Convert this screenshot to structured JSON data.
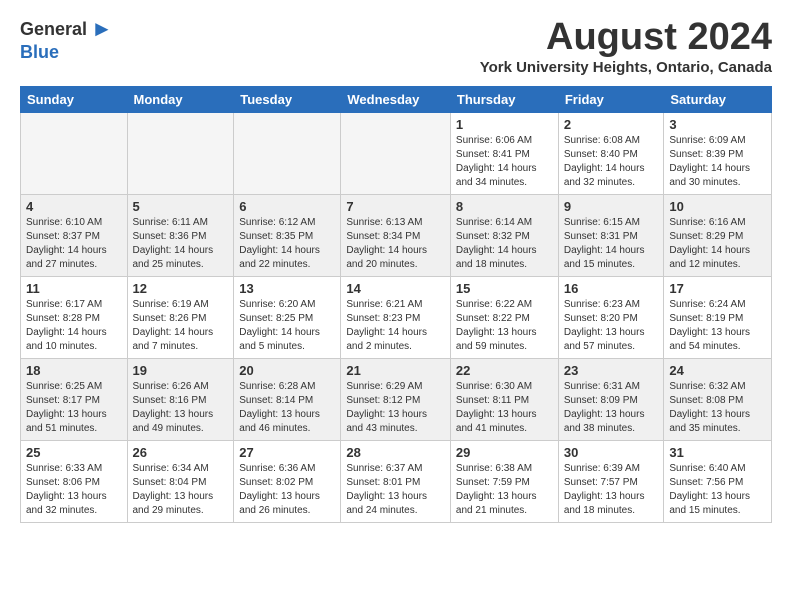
{
  "logo": {
    "general": "General",
    "blue": "Blue"
  },
  "title": "August 2024",
  "location": "York University Heights, Ontario, Canada",
  "days_of_week": [
    "Sunday",
    "Monday",
    "Tuesday",
    "Wednesday",
    "Thursday",
    "Friday",
    "Saturday"
  ],
  "weeks": [
    [
      {
        "day": "",
        "sunrise": "",
        "sunset": "",
        "daylight": ""
      },
      {
        "day": "",
        "sunrise": "",
        "sunset": "",
        "daylight": ""
      },
      {
        "day": "",
        "sunrise": "",
        "sunset": "",
        "daylight": ""
      },
      {
        "day": "",
        "sunrise": "",
        "sunset": "",
        "daylight": ""
      },
      {
        "day": "1",
        "sunrise": "Sunrise: 6:06 AM",
        "sunset": "Sunset: 8:41 PM",
        "daylight": "Daylight: 14 hours and 34 minutes."
      },
      {
        "day": "2",
        "sunrise": "Sunrise: 6:08 AM",
        "sunset": "Sunset: 8:40 PM",
        "daylight": "Daylight: 14 hours and 32 minutes."
      },
      {
        "day": "3",
        "sunrise": "Sunrise: 6:09 AM",
        "sunset": "Sunset: 8:39 PM",
        "daylight": "Daylight: 14 hours and 30 minutes."
      }
    ],
    [
      {
        "day": "4",
        "sunrise": "Sunrise: 6:10 AM",
        "sunset": "Sunset: 8:37 PM",
        "daylight": "Daylight: 14 hours and 27 minutes."
      },
      {
        "day": "5",
        "sunrise": "Sunrise: 6:11 AM",
        "sunset": "Sunset: 8:36 PM",
        "daylight": "Daylight: 14 hours and 25 minutes."
      },
      {
        "day": "6",
        "sunrise": "Sunrise: 6:12 AM",
        "sunset": "Sunset: 8:35 PM",
        "daylight": "Daylight: 14 hours and 22 minutes."
      },
      {
        "day": "7",
        "sunrise": "Sunrise: 6:13 AM",
        "sunset": "Sunset: 8:34 PM",
        "daylight": "Daylight: 14 hours and 20 minutes."
      },
      {
        "day": "8",
        "sunrise": "Sunrise: 6:14 AM",
        "sunset": "Sunset: 8:32 PM",
        "daylight": "Daylight: 14 hours and 18 minutes."
      },
      {
        "day": "9",
        "sunrise": "Sunrise: 6:15 AM",
        "sunset": "Sunset: 8:31 PM",
        "daylight": "Daylight: 14 hours and 15 minutes."
      },
      {
        "day": "10",
        "sunrise": "Sunrise: 6:16 AM",
        "sunset": "Sunset: 8:29 PM",
        "daylight": "Daylight: 14 hours and 12 minutes."
      }
    ],
    [
      {
        "day": "11",
        "sunrise": "Sunrise: 6:17 AM",
        "sunset": "Sunset: 8:28 PM",
        "daylight": "Daylight: 14 hours and 10 minutes."
      },
      {
        "day": "12",
        "sunrise": "Sunrise: 6:19 AM",
        "sunset": "Sunset: 8:26 PM",
        "daylight": "Daylight: 14 hours and 7 minutes."
      },
      {
        "day": "13",
        "sunrise": "Sunrise: 6:20 AM",
        "sunset": "Sunset: 8:25 PM",
        "daylight": "Daylight: 14 hours and 5 minutes."
      },
      {
        "day": "14",
        "sunrise": "Sunrise: 6:21 AM",
        "sunset": "Sunset: 8:23 PM",
        "daylight": "Daylight: 14 hours and 2 minutes."
      },
      {
        "day": "15",
        "sunrise": "Sunrise: 6:22 AM",
        "sunset": "Sunset: 8:22 PM",
        "daylight": "Daylight: 13 hours and 59 minutes."
      },
      {
        "day": "16",
        "sunrise": "Sunrise: 6:23 AM",
        "sunset": "Sunset: 8:20 PM",
        "daylight": "Daylight: 13 hours and 57 minutes."
      },
      {
        "day": "17",
        "sunrise": "Sunrise: 6:24 AM",
        "sunset": "Sunset: 8:19 PM",
        "daylight": "Daylight: 13 hours and 54 minutes."
      }
    ],
    [
      {
        "day": "18",
        "sunrise": "Sunrise: 6:25 AM",
        "sunset": "Sunset: 8:17 PM",
        "daylight": "Daylight: 13 hours and 51 minutes."
      },
      {
        "day": "19",
        "sunrise": "Sunrise: 6:26 AM",
        "sunset": "Sunset: 8:16 PM",
        "daylight": "Daylight: 13 hours and 49 minutes."
      },
      {
        "day": "20",
        "sunrise": "Sunrise: 6:28 AM",
        "sunset": "Sunset: 8:14 PM",
        "daylight": "Daylight: 13 hours and 46 minutes."
      },
      {
        "day": "21",
        "sunrise": "Sunrise: 6:29 AM",
        "sunset": "Sunset: 8:12 PM",
        "daylight": "Daylight: 13 hours and 43 minutes."
      },
      {
        "day": "22",
        "sunrise": "Sunrise: 6:30 AM",
        "sunset": "Sunset: 8:11 PM",
        "daylight": "Daylight: 13 hours and 41 minutes."
      },
      {
        "day": "23",
        "sunrise": "Sunrise: 6:31 AM",
        "sunset": "Sunset: 8:09 PM",
        "daylight": "Daylight: 13 hours and 38 minutes."
      },
      {
        "day": "24",
        "sunrise": "Sunrise: 6:32 AM",
        "sunset": "Sunset: 8:08 PM",
        "daylight": "Daylight: 13 hours and 35 minutes."
      }
    ],
    [
      {
        "day": "25",
        "sunrise": "Sunrise: 6:33 AM",
        "sunset": "Sunset: 8:06 PM",
        "daylight": "Daylight: 13 hours and 32 minutes."
      },
      {
        "day": "26",
        "sunrise": "Sunrise: 6:34 AM",
        "sunset": "Sunset: 8:04 PM",
        "daylight": "Daylight: 13 hours and 29 minutes."
      },
      {
        "day": "27",
        "sunrise": "Sunrise: 6:36 AM",
        "sunset": "Sunset: 8:02 PM",
        "daylight": "Daylight: 13 hours and 26 minutes."
      },
      {
        "day": "28",
        "sunrise": "Sunrise: 6:37 AM",
        "sunset": "Sunset: 8:01 PM",
        "daylight": "Daylight: 13 hours and 24 minutes."
      },
      {
        "day": "29",
        "sunrise": "Sunrise: 6:38 AM",
        "sunset": "Sunset: 7:59 PM",
        "daylight": "Daylight: 13 hours and 21 minutes."
      },
      {
        "day": "30",
        "sunrise": "Sunrise: 6:39 AM",
        "sunset": "Sunset: 7:57 PM",
        "daylight": "Daylight: 13 hours and 18 minutes."
      },
      {
        "day": "31",
        "sunrise": "Sunrise: 6:40 AM",
        "sunset": "Sunset: 7:56 PM",
        "daylight": "Daylight: 13 hours and 15 minutes."
      }
    ]
  ]
}
